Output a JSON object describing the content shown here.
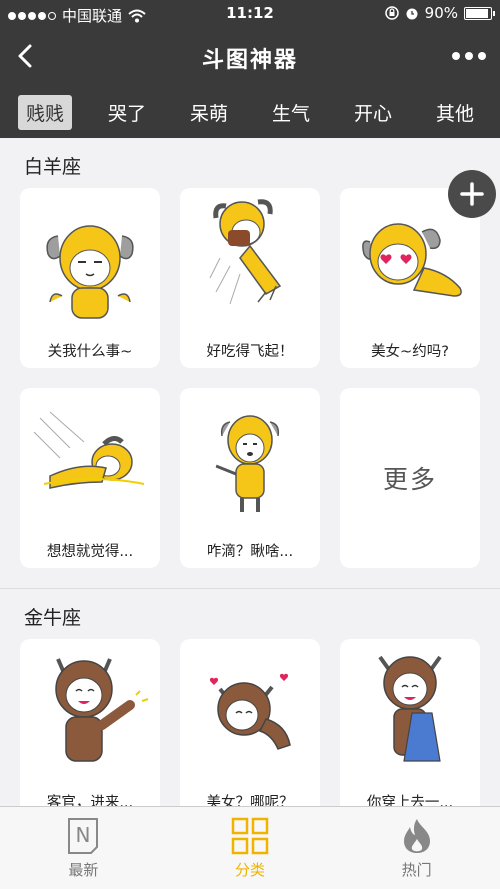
{
  "status_bar": {
    "carrier": "中国联通",
    "time": "11:12",
    "battery": "90%",
    "battery_level": 0.9
  },
  "nav": {
    "title": "斗图神器"
  },
  "tabs": [
    {
      "label": "贱贱",
      "active": true
    },
    {
      "label": "哭了",
      "active": false
    },
    {
      "label": "呆萌",
      "active": false
    },
    {
      "label": "生气",
      "active": false
    },
    {
      "label": "开心",
      "active": false
    },
    {
      "label": "其他",
      "active": false
    }
  ],
  "sections": [
    {
      "title": "白羊座",
      "items": [
        {
          "caption": "关我什么事~",
          "image": "aries-shrug-sticker"
        },
        {
          "caption": "好吃得飞起！",
          "image": "aries-eating-sticker"
        },
        {
          "caption": "美女~约吗?",
          "image": "aries-heart-eyes-sticker"
        },
        {
          "caption": "想想就觉得...",
          "image": "aries-falling-sticker"
        },
        {
          "caption": "咋滴？瞅啥...",
          "image": "aries-smoking-sticker"
        }
      ],
      "more_label": "更多"
    },
    {
      "title": "金牛座",
      "items": [
        {
          "caption": "客官，进来...",
          "image": "taurus-waving-sticker"
        },
        {
          "caption": "美女？哪呢？",
          "image": "taurus-hearts-sticker"
        },
        {
          "caption": "你穿上去一...",
          "image": "taurus-dress-sticker"
        }
      ]
    }
  ],
  "bottom_tabs": [
    {
      "label": "最新",
      "icon": "newspaper-icon",
      "active": false
    },
    {
      "label": "分类",
      "icon": "grid-icon",
      "active": true
    },
    {
      "label": "热门",
      "icon": "flame-icon",
      "active": false
    }
  ],
  "colors": {
    "header_bg": "#3a3a3a",
    "accent": "#f0b400",
    "aries_yellow": "#f5c518",
    "taurus_brown": "#8b5a3c"
  }
}
